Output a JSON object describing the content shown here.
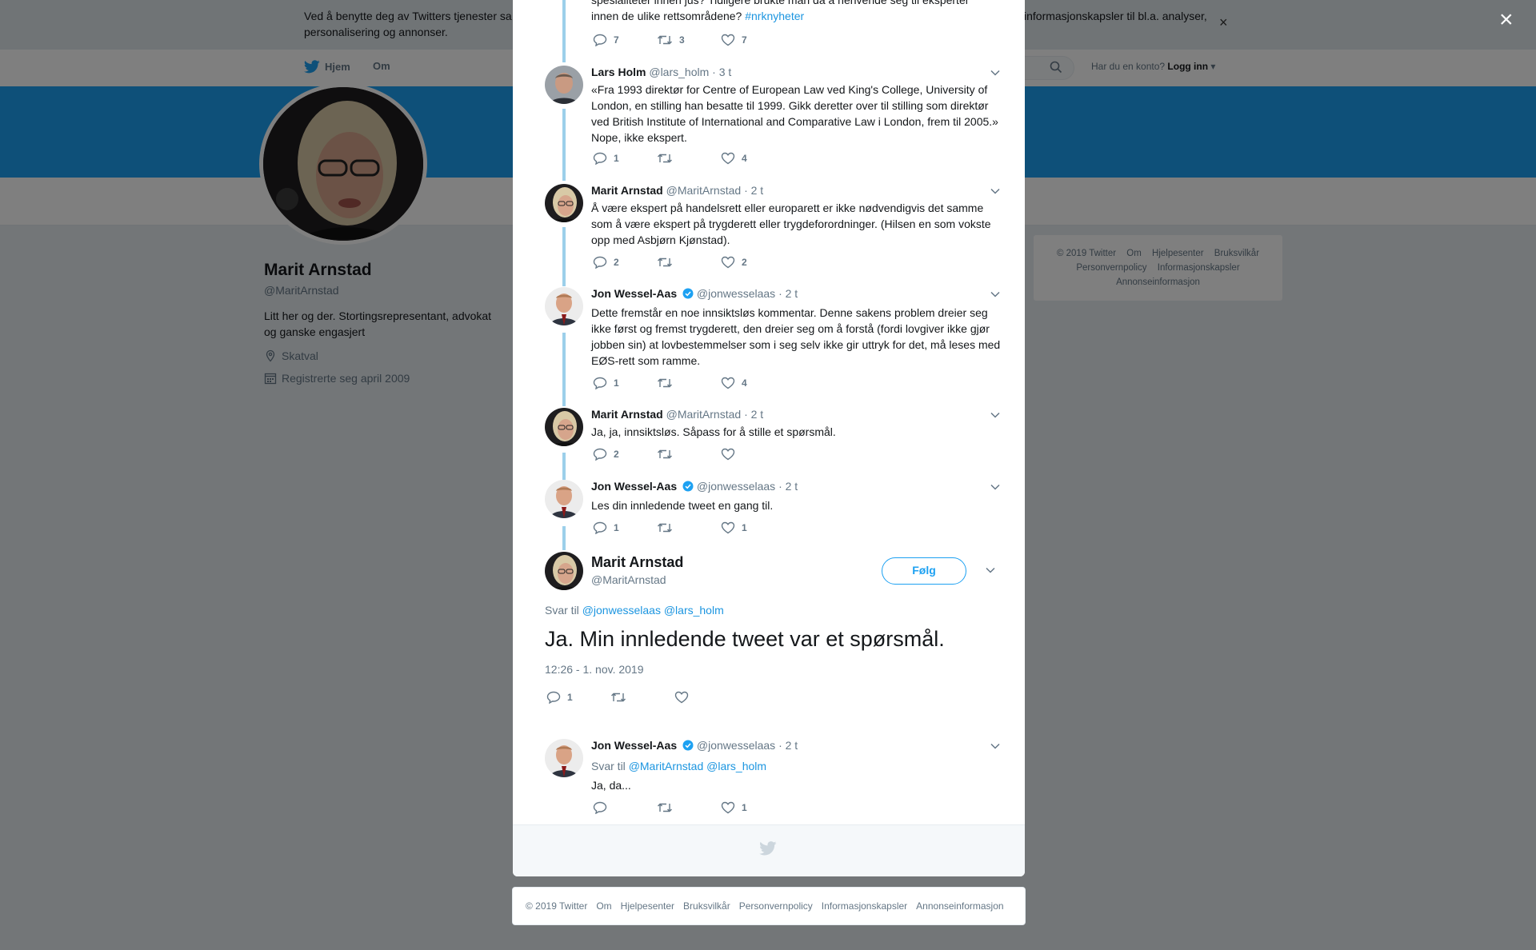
{
  "cookie_banner": {
    "text_left": "Ved å benytte deg av Twitters tjenester sa",
    "text_right": "informasjonskapsler til bl.a. analyser,",
    "text_line2": "personalisering og annonser.",
    "close": "×"
  },
  "topnav": {
    "home": "Hjem",
    "about": "Om",
    "login_prompt": "Har du en konto?",
    "login_link": "Logg inn"
  },
  "profile": {
    "name": "Marit Arnstad",
    "handle": "@MaritArnstad",
    "bio": "Litt her og der. Stortingsrepresentant, advokat og ganske engasjert",
    "location": "Skatval",
    "joined": "Registrerte seg april 2009"
  },
  "side_footer": {
    "items": [
      "© 2019 Twitter",
      "Om",
      "Hjelpesenter",
      "Bruksvilkår",
      "Personvernpolicy",
      "Informasjonskapsler",
      "Annonseinformasjon"
    ]
  },
  "overlay_close": "×",
  "thread": {
    "top_partial": {
      "text_line1": "spesialiteter innen jus? Tidligere brukte man da å henvende seg til eksperter",
      "text_line2": "innen de ulike rettsområdene?",
      "hashtag": "#nrknyheter",
      "replies": "7",
      "retweets": "3",
      "likes": "7"
    },
    "tweets": [
      {
        "name": "Lars Holm",
        "handle": "@lars_holm",
        "time": "· 3 t",
        "verified": false,
        "text": "«Fra 1993 direktør for Centre of European Law ved King's College, University of London, en stilling han besatte til 1999. Gikk deretter over til stilling som direktør ved British Institute of International and Comparative Law i London, frem til 2005.» Nope, ikke ekspert.",
        "replies": "1",
        "retweets": "",
        "likes": "4"
      },
      {
        "name": "Marit Arnstad",
        "handle": "@MaritArnstad",
        "time": "· 2 t",
        "verified": false,
        "text": "Å være ekspert på handelsrett eller europarett er ikke nødvendigvis det samme som å være ekspert på trygderett eller trygdeforordninger. (Hilsen en som vokste opp med Asbjørn Kjønstad).",
        "replies": "2",
        "retweets": "",
        "likes": "2"
      },
      {
        "name": "Jon Wessel-Aas",
        "handle": "@jonwesselaas",
        "time": "· 2 t",
        "verified": true,
        "text": "Dette fremstår en noe innsiktsløs kommentar. Denne sakens problem dreier seg ikke først og fremst trygderett, den dreier seg om å forstå (fordi lovgiver ikke gjør jobben sin) at lovbestemmelser som i seg selv ikke gir uttryk for det, må leses med EØS-rett som ramme.",
        "replies": "1",
        "retweets": "",
        "likes": "4"
      },
      {
        "name": "Marit Arnstad",
        "handle": "@MaritArnstad",
        "time": "· 2 t",
        "verified": false,
        "text": "Ja, ja, innsiktsløs. Såpass for å stille et spørsmål.",
        "replies": "2",
        "retweets": "",
        "likes": ""
      },
      {
        "name": "Jon Wessel-Aas",
        "handle": "@jonwesselaas",
        "time": "· 2 t",
        "verified": true,
        "text": "Les din innledende tweet en gang til.",
        "replies": "1",
        "retweets": "",
        "likes": "1"
      }
    ],
    "main": {
      "name": "Marit Arnstad",
      "handle": "@MaritArnstad",
      "follow": "Følg",
      "reply_prefix": "Svar til",
      "reply_users": "@jonwesselaas @lars_holm",
      "text": "Ja. Min innledende tweet var et spørsmål.",
      "date": "12:26 - 1. nov. 2019",
      "replies": "1",
      "retweets": "",
      "likes": ""
    },
    "reply": {
      "name": "Jon Wessel-Aas",
      "handle": "@jonwesselaas",
      "time": "· 2 t",
      "verified": true,
      "reply_prefix": "Svar til",
      "reply_users": "@MaritArnstad @lars_holm",
      "text": "Ja, da...",
      "replies": "",
      "retweets": "",
      "likes": "1"
    }
  },
  "bottom_footer": {
    "items": [
      "© 2019 Twitter",
      "Om",
      "Hjelpesenter",
      "Bruksvilkår",
      "Personvernpolicy",
      "Informasjonskapsler",
      "Annonseinformasjon"
    ]
  },
  "colors": {
    "twitter_blue": "#1da1f2",
    "link": "#1b95e0",
    "secondary_text": "#657786",
    "thread_line": "#9ccfea"
  },
  "icons": {
    "reply": "reply-icon",
    "retweet": "retweet-icon",
    "like": "heart-icon",
    "caret": "chevron-down-icon",
    "verified": "verified-badge-icon",
    "bird": "twitter-bird-icon"
  }
}
